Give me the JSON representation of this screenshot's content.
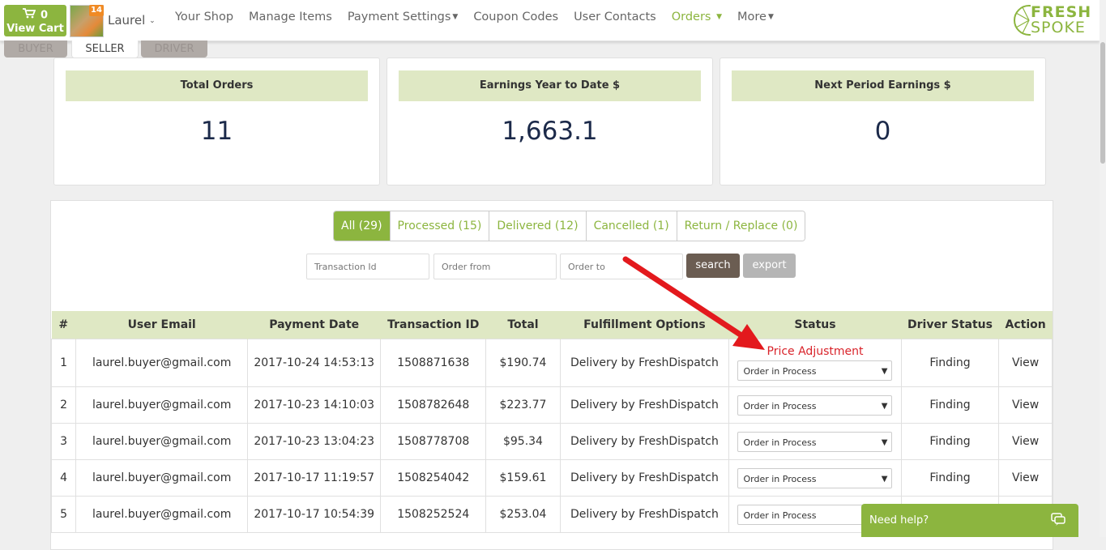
{
  "header": {
    "cart": {
      "count": "0",
      "label": "View Cart"
    },
    "avatar_badge": "14",
    "username": "Laurel",
    "nav": [
      {
        "label": "Your Shop",
        "dropdown": false,
        "active": false
      },
      {
        "label": "Manage Items",
        "dropdown": false,
        "active": false
      },
      {
        "label": "Payment Settings",
        "dropdown": true,
        "active": false
      },
      {
        "label": "Coupon Codes",
        "dropdown": false,
        "active": false
      },
      {
        "label": "User Contacts",
        "dropdown": false,
        "active": false
      },
      {
        "label": "Orders",
        "dropdown": true,
        "active": true
      },
      {
        "label": "More",
        "dropdown": true,
        "active": false
      }
    ],
    "logo": {
      "line1": "FRESH",
      "line2": "SPOKE"
    }
  },
  "roles": {
    "buyer": "BUYER",
    "seller": "SELLER",
    "driver": "DRIVER"
  },
  "stats": [
    {
      "label": "Total Orders",
      "value": "11"
    },
    {
      "label": "Earnings Year to Date $",
      "value": "1,663.1"
    },
    {
      "label": "Next Period Earnings $",
      "value": "0"
    }
  ],
  "filters": {
    "tabs": [
      "All (29)",
      "Processed (15)",
      "Delivered (12)",
      "Cancelled (1)",
      "Return / Replace (0)"
    ],
    "transaction_placeholder": "Transaction Id",
    "order_from_placeholder": "Order from",
    "order_to_placeholder": "Order to",
    "search_label": "search",
    "export_label": "export"
  },
  "table": {
    "headers": [
      "#",
      "User Email",
      "Payment Date",
      "Transaction ID",
      "Total",
      "Fulfillment Options",
      "Status",
      "Driver Status",
      "Action"
    ],
    "rows": [
      {
        "num": "1",
        "email": "laurel.buyer@gmail.com",
        "date": "2017-10-24 14:53:13",
        "txn": "1508871638",
        "total": "$190.74",
        "fulfillment": "Delivery by FreshDispatch",
        "note": "Price Adjustment",
        "status": "Order in Process",
        "driver": "Finding",
        "action": "View"
      },
      {
        "num": "2",
        "email": "laurel.buyer@gmail.com",
        "date": "2017-10-23 14:10:03",
        "txn": "1508782648",
        "total": "$223.77",
        "fulfillment": "Delivery by FreshDispatch",
        "note": "",
        "status": "Order in Process",
        "driver": "Finding",
        "action": "View"
      },
      {
        "num": "3",
        "email": "laurel.buyer@gmail.com",
        "date": "2017-10-23 13:04:23",
        "txn": "1508778708",
        "total": "$95.34",
        "fulfillment": "Delivery by FreshDispatch",
        "note": "",
        "status": "Order in Process",
        "driver": "Finding",
        "action": "View"
      },
      {
        "num": "4",
        "email": "laurel.buyer@gmail.com",
        "date": "2017-10-17 11:19:57",
        "txn": "1508254042",
        "total": "$159.61",
        "fulfillment": "Delivery by FreshDispatch",
        "note": "",
        "status": "Order in Process",
        "driver": "Finding",
        "action": "View"
      },
      {
        "num": "5",
        "email": "laurel.buyer@gmail.com",
        "date": "2017-10-17 10:54:39",
        "txn": "1508252524",
        "total": "$253.04",
        "fulfillment": "Delivery by FreshDispatch",
        "note": "",
        "status": "Order in Process",
        "driver": "Finding",
        "action": "View"
      }
    ]
  },
  "help": {
    "label": "Need help?"
  },
  "colors": {
    "accent": "#8cb53f",
    "header_fill": "#dfe8c4",
    "alert": "#d9232a",
    "search_btn": "#6b5d52",
    "export_btn": "#b5b5b5"
  }
}
